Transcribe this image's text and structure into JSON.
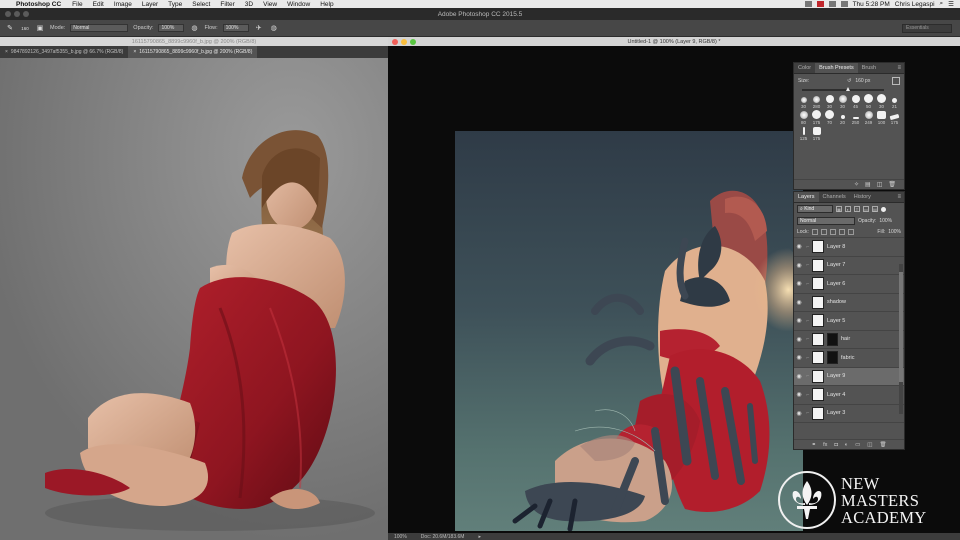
{
  "menubar": {
    "app_name": "Photoshop CC",
    "items": [
      "File",
      "Edit",
      "Image",
      "Layer",
      "Type",
      "Select",
      "Filter",
      "3D",
      "View",
      "Window",
      "Help"
    ],
    "time": "Thu 5:28 PM",
    "user": "Chris Legaspi"
  },
  "app": {
    "title": "Adobe Photoshop CC 2015.5"
  },
  "options": {
    "brush_size": "160",
    "mode_label": "Mode:",
    "mode_value": "Normal",
    "opacity_label": "Opacity:",
    "opacity_value": "100%",
    "flow_label": "Flow:",
    "flow_value": "100%",
    "workspace": "Essentials"
  },
  "left_doc": {
    "title": "16115790865_8899c9960f_b.jpg @ 200% (RGB/8)",
    "tabs": [
      "9847892126_3497af5355_b.jpg @ 66.7% (RGB/8)",
      "16115790865_8899c9960f_b.jpg @ 200% (RGB/8)"
    ]
  },
  "right_doc": {
    "title": "Untitled-1 @ 100% (Layer 9, RGB/8) *",
    "zoom": "100%",
    "doc_size": "Doc: 20.6M/183.6M"
  },
  "brush_panel": {
    "tabs": [
      "Color",
      "Brush Presets",
      "Brush"
    ],
    "active_tab": "Brush Presets",
    "size_label": "Size:",
    "size_value": "160 px",
    "presets": [
      "30",
      "280",
      "30",
      "30",
      "45",
      "50",
      "30",
      "21",
      "80",
      "175",
      "70",
      "20",
      "250",
      "249",
      "100",
      "175",
      "125",
      "175"
    ]
  },
  "layers_panel": {
    "tabs": [
      "Layers",
      "Channels",
      "History"
    ],
    "active_tab": "Layers",
    "filter": "Kind",
    "blend_mode": "Normal",
    "opacity_label": "Opacity:",
    "opacity_value": "100%",
    "lock_label": "Lock:",
    "fill_label": "Fill:",
    "fill_value": "100%",
    "layers": [
      {
        "name": "Layer 8",
        "active": false,
        "mask": false
      },
      {
        "name": "Layer 7",
        "active": false,
        "mask": false
      },
      {
        "name": "Layer 6",
        "active": false,
        "mask": false
      },
      {
        "name": "shadow",
        "active": false,
        "mask": false
      },
      {
        "name": "Layer 5",
        "active": false,
        "mask": false
      },
      {
        "name": "hair",
        "active": false,
        "mask": true
      },
      {
        "name": "fabric",
        "active": false,
        "mask": true
      },
      {
        "name": "Layer 9",
        "active": true,
        "mask": false
      },
      {
        "name": "Layer 4",
        "active": false,
        "mask": false
      },
      {
        "name": "Layer 3",
        "active": false,
        "mask": false
      }
    ]
  },
  "logo": {
    "lines": [
      "NEW",
      "MASTERS",
      "ACADEMY"
    ]
  },
  "colors": {
    "fabric_red": "#a51d2a",
    "brush_stroke": "#3d4753"
  }
}
